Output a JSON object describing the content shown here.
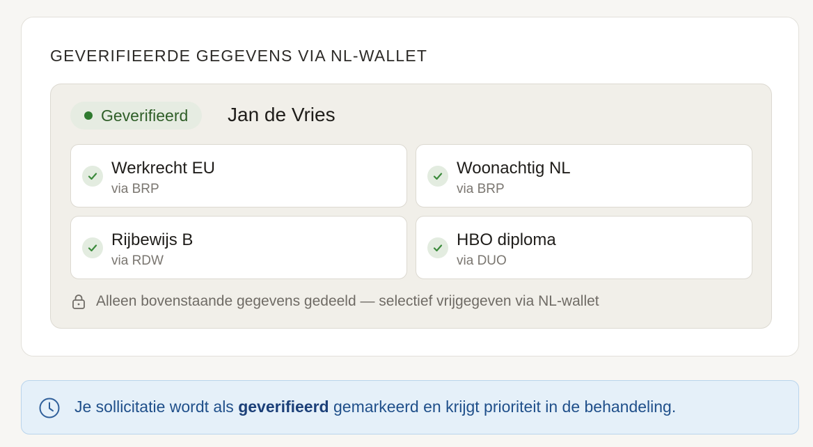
{
  "section": {
    "title": "GEVERIFIEERDE GEGEVENS VIA NL-WALLET"
  },
  "badge": {
    "label": "Geverifieerd",
    "dot_color": "#2f7a2f"
  },
  "person": {
    "name": "Jan de Vries"
  },
  "credentials": [
    {
      "title": "Werkrecht EU",
      "source": "via BRP",
      "icon": "check-icon"
    },
    {
      "title": "Woonachtig NL",
      "source": "via BRP",
      "icon": "check-icon"
    },
    {
      "title": "Rijbewijs B",
      "source": "via RDW",
      "icon": "check-icon"
    },
    {
      "title": "HBO diploma",
      "source": "via DUO",
      "icon": "check-icon"
    }
  ],
  "footnote": {
    "icon": "lock-icon",
    "text": "Alleen bovenstaande gegevens gedeeld — selectief vrijgegeven via NL-wallet"
  },
  "banner": {
    "icon": "clock-icon",
    "text_before": "Je sollicitatie wordt als ",
    "text_strong": "geverifieerd",
    "text_after": " gemarkeerd en krijgt prioriteit in de behandeling.",
    "accent_color": "#1f4f8a"
  }
}
